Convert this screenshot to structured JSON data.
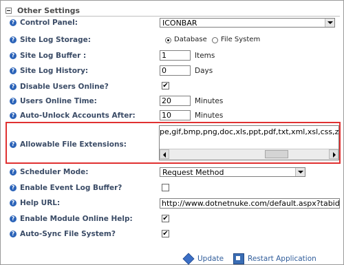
{
  "section": {
    "title": "Other Settings"
  },
  "help_glyph": "?",
  "fields": {
    "control_panel": {
      "label": "Control Panel:",
      "value": "ICONBAR"
    },
    "site_log_storage": {
      "label": "Site Log Storage:",
      "options": [
        "Database",
        "File System"
      ],
      "selected": "Database"
    },
    "site_log_buffer": {
      "label": "Site Log Buffer :",
      "value": "1",
      "unit": "Items"
    },
    "site_log_history": {
      "label": "Site Log History:",
      "value": "0",
      "unit": "Days"
    },
    "disable_users_online": {
      "label": "Disable Users Online?",
      "checked": true
    },
    "users_online_time": {
      "label": "Users Online Time:",
      "value": "20",
      "unit": "Minutes"
    },
    "auto_unlock": {
      "label": "Auto-Unlock Accounts After:",
      "value": "10",
      "unit": "Minutes"
    },
    "file_extensions": {
      "label": "Allowable File Extensions:",
      "value": "pe,gif,bmp,png,doc,xls,ppt,pdf,txt,xml,xsl,css,zip"
    },
    "scheduler_mode": {
      "label": "Scheduler Mode:",
      "value": "Request Method"
    },
    "event_log_buffer": {
      "label": "Enable Event Log Buffer?",
      "checked": false
    },
    "help_url": {
      "label": "Help URL:",
      "value": "http://www.dotnetnuke.com/default.aspx?tabid"
    },
    "module_online_help": {
      "label": "Enable Module Online Help:",
      "checked": true
    },
    "auto_sync": {
      "label": "Auto-Sync File System?",
      "checked": true
    }
  },
  "actions": {
    "update": "Update",
    "restart": "Restart Application"
  },
  "check_glyph": "✔",
  "colors": {
    "label": "#3a4b66",
    "link": "#2f5c9a",
    "highlight": "#e03030",
    "help_icon": "#2b63b8"
  }
}
